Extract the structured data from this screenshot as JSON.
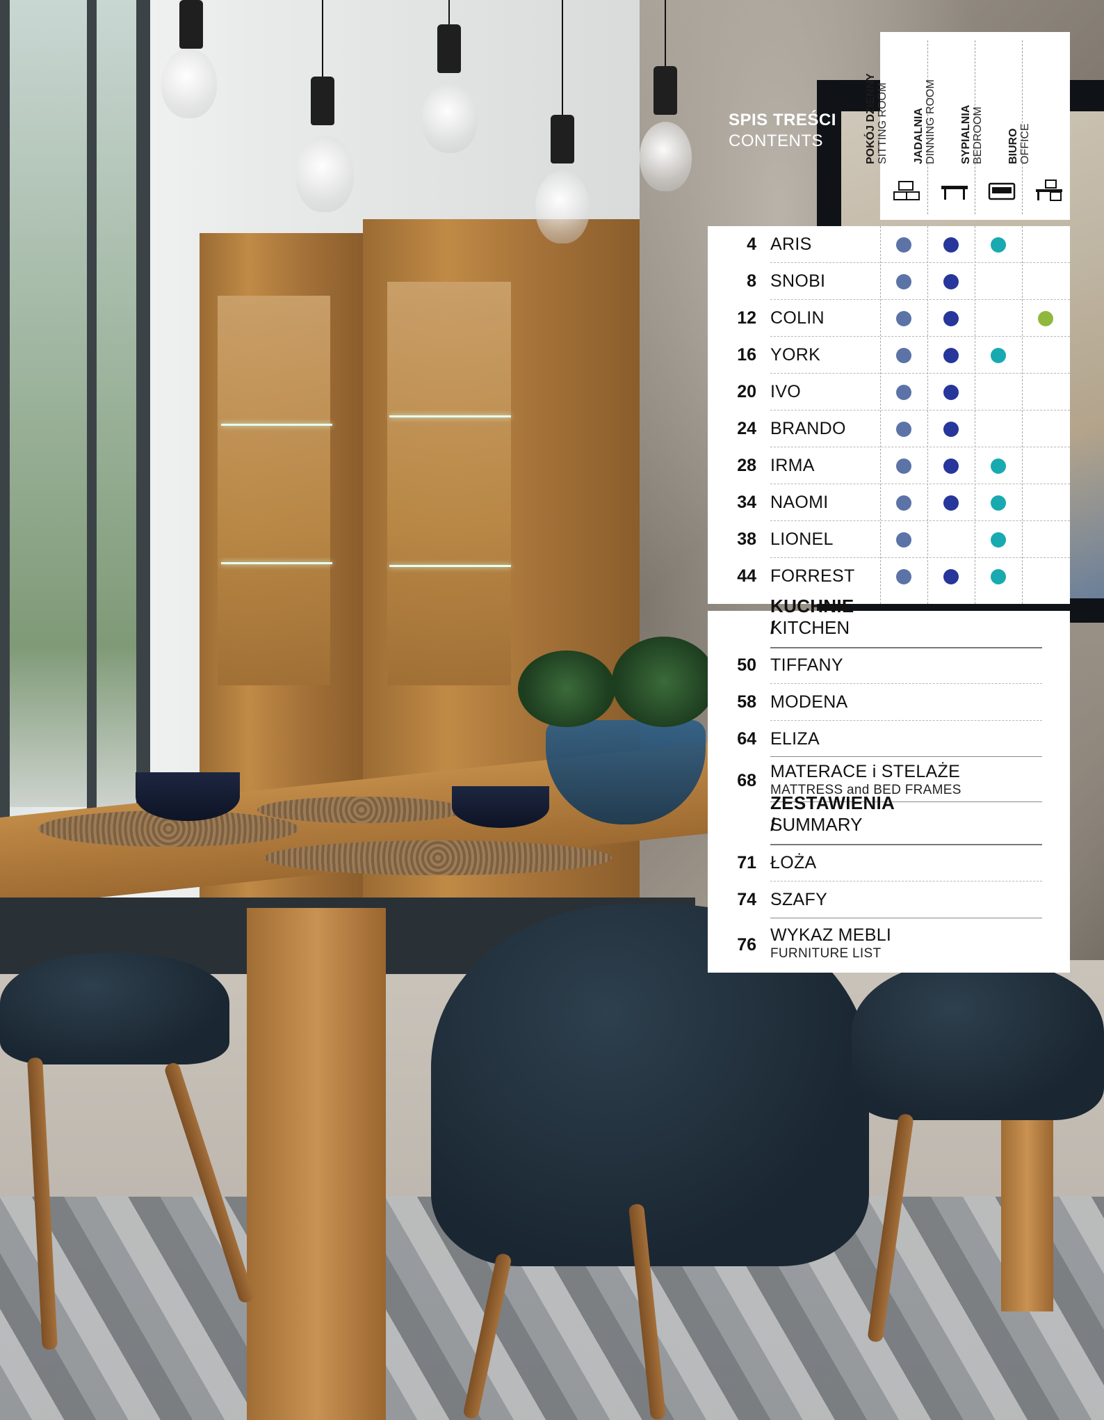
{
  "header": {
    "title_pl": "SPIS TREŚCI",
    "title_en": "CONTENTS"
  },
  "categories": [
    {
      "pl": "POKÓJ DZIENNY",
      "en": "SITTING ROOM",
      "icon": "tv-cabinet-icon"
    },
    {
      "pl": "JADALNIA",
      "en": "DINNING ROOM",
      "icon": "dining-table-icon"
    },
    {
      "pl": "SYPIALNIA",
      "en": "BEDROOM",
      "icon": "bed-icon"
    },
    {
      "pl": "BIURO",
      "en": "OFFICE",
      "icon": "desk-icon"
    }
  ],
  "colors": {
    "sitting_room": "#5b73a6",
    "dinning_room": "#27369a",
    "bedroom": "#18aab0",
    "office": "#8fb83d"
  },
  "collections": [
    {
      "page": "4",
      "name": "ARIS",
      "marks": [
        true,
        true,
        true,
        false
      ]
    },
    {
      "page": "8",
      "name": "SNOBI",
      "marks": [
        true,
        true,
        false,
        false
      ]
    },
    {
      "page": "12",
      "name": "COLIN",
      "marks": [
        true,
        true,
        false,
        true
      ]
    },
    {
      "page": "16",
      "name": "YORK",
      "marks": [
        true,
        true,
        true,
        false
      ]
    },
    {
      "page": "20",
      "name": "IVO",
      "marks": [
        true,
        true,
        false,
        false
      ]
    },
    {
      "page": "24",
      "name": "BRANDO",
      "marks": [
        true,
        true,
        false,
        false
      ]
    },
    {
      "page": "28",
      "name": "IRMA",
      "marks": [
        true,
        true,
        true,
        false
      ]
    },
    {
      "page": "34",
      "name": "NAOMI",
      "marks": [
        true,
        true,
        true,
        false
      ]
    },
    {
      "page": "38",
      "name": "LIONEL",
      "marks": [
        true,
        false,
        true,
        false
      ]
    },
    {
      "page": "44",
      "name": "FORREST",
      "marks": [
        true,
        true,
        true,
        false
      ]
    }
  ],
  "kitchen": {
    "heading_bold": "KUCHNIE /",
    "heading_light": "KITCHEN",
    "items": [
      {
        "page": "50",
        "name": "TIFFANY"
      },
      {
        "page": "58",
        "name": "MODENA"
      },
      {
        "page": "64",
        "name": "ELIZA"
      },
      {
        "page": "68",
        "name": "MATERACE i STELAŻE",
        "sub": "MATTRESS and BED FRAMES"
      }
    ]
  },
  "summary": {
    "heading_bold": "ZESTAWIENIA /",
    "heading_light": "SUMMARY",
    "items": [
      {
        "page": "71",
        "name": "ŁOŻA"
      },
      {
        "page": "74",
        "name": "SZAFY"
      },
      {
        "page": "76",
        "name": "WYKAZ MEBLI",
        "sub": "FURNITURE LIST"
      }
    ]
  }
}
